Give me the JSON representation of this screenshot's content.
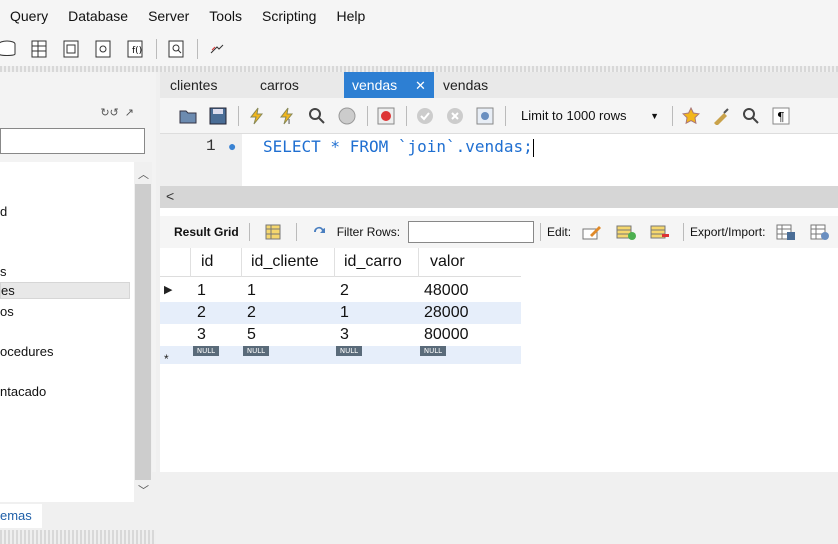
{
  "menu": [
    "Query",
    "Database",
    "Server",
    "Tools",
    "Scripting",
    "Help"
  ],
  "editor_tabs": [
    {
      "label": "clientes",
      "active": false
    },
    {
      "label": "carros",
      "active": false
    },
    {
      "label": "vendas",
      "active": true,
      "close": "✕"
    },
    {
      "label": "vendas",
      "active": false
    }
  ],
  "sidebar": {
    "items": [
      "d",
      "s",
      "es",
      "os",
      "ocedures",
      "ntacado"
    ],
    "bottom_tab": "emas"
  },
  "query_toolbar": {
    "limit_label": "Limit to 1000 rows"
  },
  "editor": {
    "line_number": "1",
    "sql": "SELECT * FROM `join`.vendas;"
  },
  "result_toolbar": {
    "result_grid": "Result Grid",
    "filter_rows": "Filter Rows:",
    "edit": "Edit:",
    "export_import": "Export/Import:"
  },
  "grid": {
    "columns": [
      "id",
      "id_cliente",
      "id_carro",
      "valor"
    ],
    "rows": [
      [
        "1",
        "1",
        "2",
        "48000"
      ],
      [
        "2",
        "2",
        "1",
        "28000"
      ],
      [
        "3",
        "5",
        "3",
        "80000"
      ]
    ],
    "null_label": "NULL",
    "new_row_marker": "*"
  },
  "colors": {
    "active_tab": "#2d7fd3",
    "sql_text": "#1f6fd1",
    "alt_row": "#e6eefa"
  }
}
